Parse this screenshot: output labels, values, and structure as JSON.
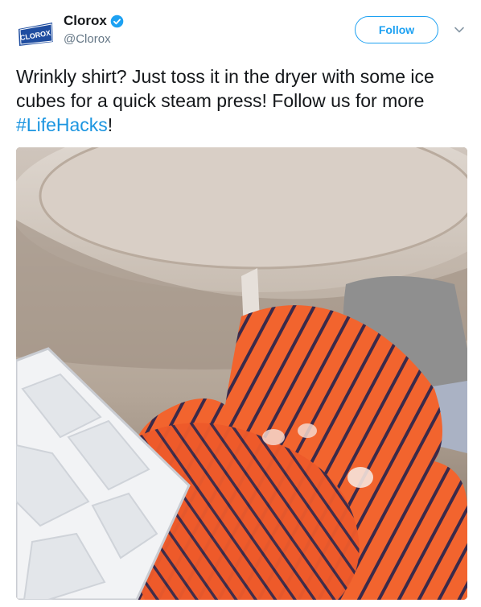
{
  "user": {
    "display_name": "Clorox",
    "handle": "@Clorox",
    "avatar_text": "CLOROX",
    "verified": true
  },
  "actions": {
    "follow_label": "Follow"
  },
  "tweet": {
    "text_main": "Wrinkly shirt? Just toss it in the dryer with some ice cubes for a quick steam press! Follow us for more ",
    "hashtag": "#LifeHacks",
    "text_end": "!"
  },
  "icons": {
    "verified": "verified-badge-icon",
    "caret": "chevron-down-icon"
  },
  "colors": {
    "accent": "#1da1f2",
    "hashtag": "#1b95e0",
    "handle": "#657786",
    "brand_blue": "#1f4da0"
  }
}
